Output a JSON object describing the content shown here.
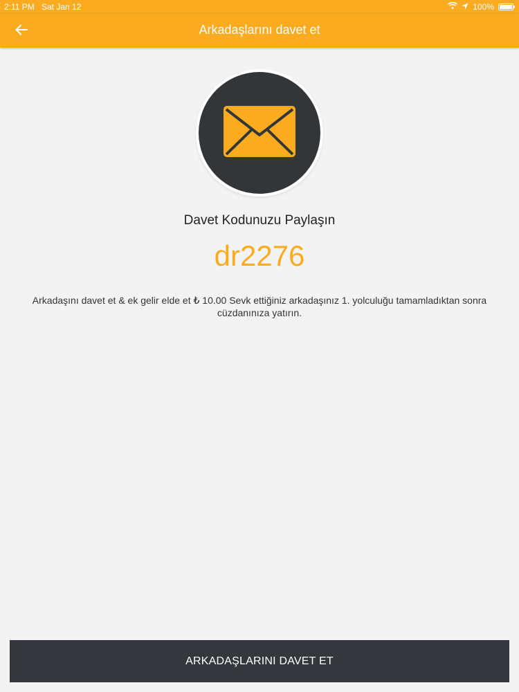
{
  "status_bar": {
    "time": "2:11 PM",
    "date": "Sat Jan 12",
    "battery_text": "100%",
    "battery_level": 1.0
  },
  "app_bar": {
    "title": "Arkadaşlarını davet et",
    "back_icon": "arrow-left-icon"
  },
  "main": {
    "icon": "envelope-icon",
    "heading": "Davet Kodunuzu Paylaşın",
    "invite_code": "dr2276",
    "description": "Arkadaşını davet et & ek gelir elde et ₺ 10.00 Sevk ettiğiniz arkadaşınız 1. yolculuğu tamamladıktan sonra cüzdanınıza yatırın."
  },
  "footer": {
    "invite_button_label": "ARKADAŞLARINI DAVET ET"
  },
  "colors": {
    "accent": "#fbab20",
    "dark": "#34373b",
    "background": "#f3f3f3"
  }
}
